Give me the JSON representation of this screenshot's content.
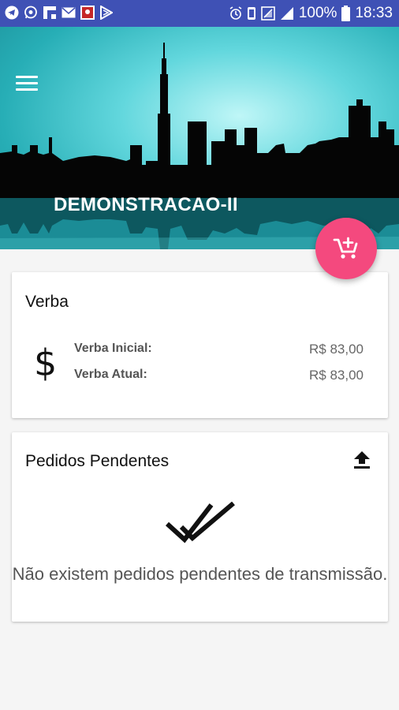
{
  "status_bar": {
    "notification_icons": [
      "telegram-icon",
      "whatsapp-icon",
      "flipboard-icon",
      "mail-icon",
      "app-badge-icon",
      "play-icon"
    ],
    "battery_percent": "100%",
    "time": "18:33"
  },
  "header": {
    "account_name": "DEMONSTRACAO-II",
    "menu_icon": "hamburger-menu-icon",
    "fab_icon": "add-to-cart-icon"
  },
  "budget_card": {
    "title": "Verba",
    "icon": "dollar-icon",
    "icon_glyph": "$",
    "rows": [
      {
        "label": "Verba Inicial:",
        "value": "R$ 83,00"
      },
      {
        "label": "Verba Atual:",
        "value": "R$ 83,00"
      }
    ]
  },
  "orders_card": {
    "title": "Pedidos Pendentes",
    "action_icon": "upload-icon",
    "empty_icon": "double-check-icon",
    "empty_message": "Não existem pedidos pendentes de transmissão."
  },
  "colors": {
    "status_bar": "#3f51b5",
    "header": "#27aeb6",
    "fab": "#f4497e",
    "background": "#f5f5f5"
  }
}
